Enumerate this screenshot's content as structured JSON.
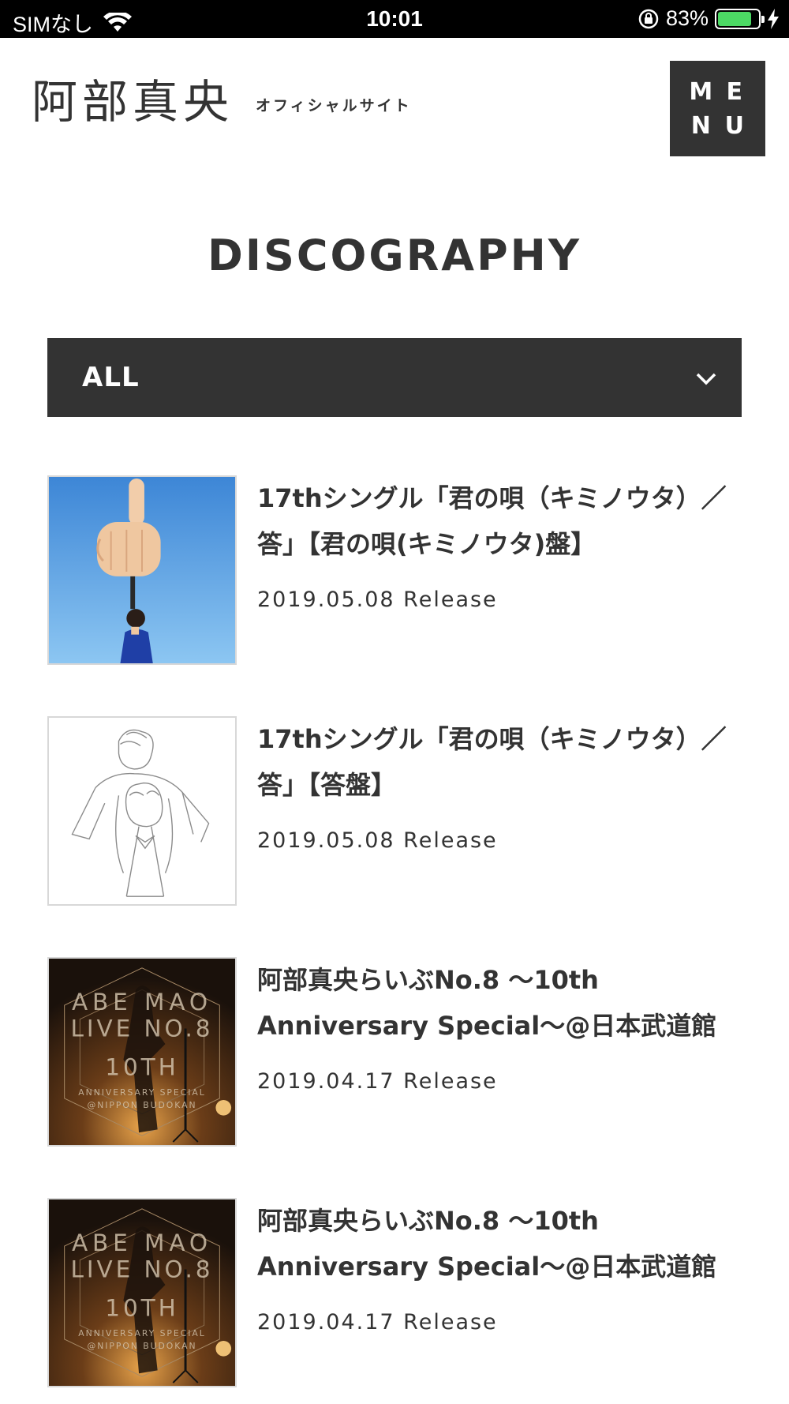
{
  "status_bar": {
    "carrier": "SIMなし",
    "time": "10:01",
    "battery_pct": "83%",
    "battery_level": 0.83,
    "battery_color": "#4cd964",
    "icons": [
      "wifi-icon",
      "rotation-lock-icon",
      "battery-icon",
      "charging-bolt-icon"
    ]
  },
  "header": {
    "logo_name": "阿部真央",
    "logo_sub": "オフィシャルサイト",
    "menu_letters": [
      "M",
      "E",
      "N",
      "U"
    ]
  },
  "page": {
    "title": "DISCOGRAPHY"
  },
  "filter": {
    "selected": "ALL",
    "icon": "chevron-down-icon"
  },
  "items": [
    {
      "title": "17thシングル「君の唄（キミノウタ）／答」【君の唄(キミノウタ)盤】",
      "date": "2019.05.08 Release",
      "thumb": "blue-sky-hand-cover"
    },
    {
      "title": "17thシングル「君の唄（キミノウタ）／答」【答盤】",
      "date": "2019.05.08 Release",
      "thumb": "pencil-sketch-cover"
    },
    {
      "title": "阿部真央らいぶNo.8 〜10th Anniversary Special〜@日本武道館",
      "date": "2019.04.17 Release",
      "thumb": "live-stage-cover",
      "cover_text": [
        "ABE MAO",
        "LIVE NO.8",
        "10TH",
        "ANNIVERSARY SPECIAL",
        "@NIPPON BUDOKAN"
      ]
    },
    {
      "title": "阿部真央らいぶNo.8 〜10th Anniversary Special〜@日本武道館",
      "date": "2019.04.17 Release",
      "thumb": "live-stage-cover",
      "cover_text": [
        "ABE MAO",
        "LIVE NO.8",
        "10TH",
        "ANNIVERSARY SPECIAL",
        "@NIPPON BUDOKAN"
      ]
    }
  ]
}
